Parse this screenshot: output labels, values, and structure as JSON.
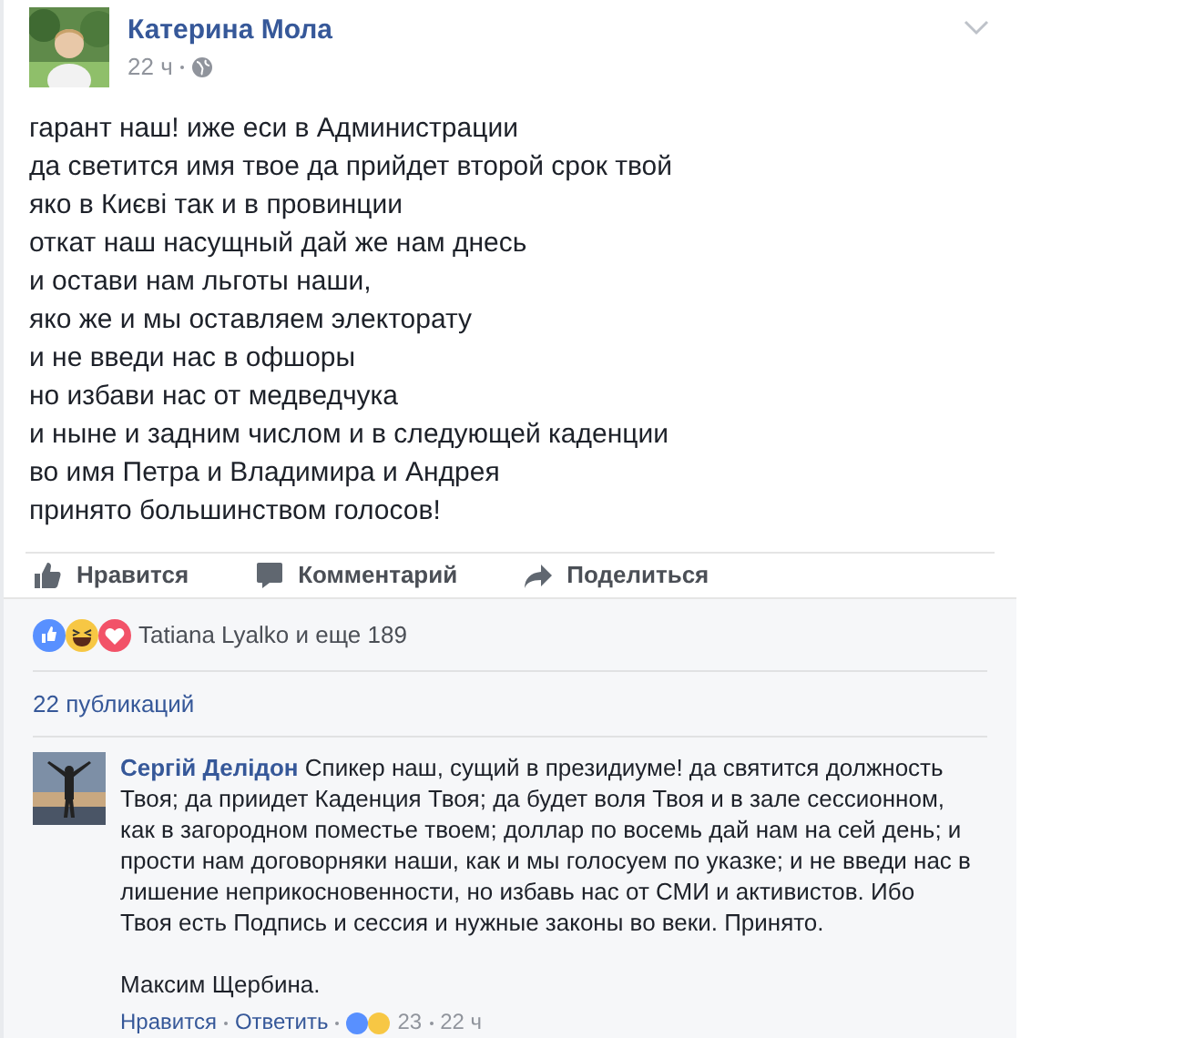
{
  "post": {
    "author": "Катерина Мола",
    "time": "22 ч",
    "lines": [
      "гарант наш! иже еси в Администрации",
      "да светится имя твое да прийдет второй срок твой",
      "яко в Києві так и в провинции",
      "откат наш насущный дай же нам днесь",
      "и остави нам льготы наши,",
      "яко же и мы оставляем электорату",
      "и не введи нас в офшоры",
      "но избави нас от медведчука",
      "и ныне и задним числом и в следующей каденции",
      "во имя Петра и Владимира и Андрея",
      "принято большинством голосов!"
    ]
  },
  "actions": [
    {
      "kind": "like",
      "label": "Нравится"
    },
    {
      "kind": "comment",
      "label": "Комментарий"
    },
    {
      "kind": "share",
      "label": "Поделиться"
    }
  ],
  "reactions": {
    "text": "Tatiana Lyalko и еще 189"
  },
  "shares": "22 публикаций",
  "comment": {
    "author": "Сергій Делідон",
    "text": "Спикер наш, сущий в президиуме! да святится должность Твоя; да приидет Каденция Твоя; да будет воля Твоя и в зале сессионном, как в загородном поместье твоем; доллар по восемь дай нам на сей день; и прости нам договорняки наши, как и мы голосуем по указке; и не введи нас в лишение неприкосновенности, но избавь нас от СМИ и активистов. Ибо Твоя есть Подпись и сессия и нужные законы во веки. Принято.",
    "signature": "Максим Щербина.",
    "like": "Нравится",
    "reply": "Ответить",
    "count": "23",
    "time": "22 ч"
  }
}
